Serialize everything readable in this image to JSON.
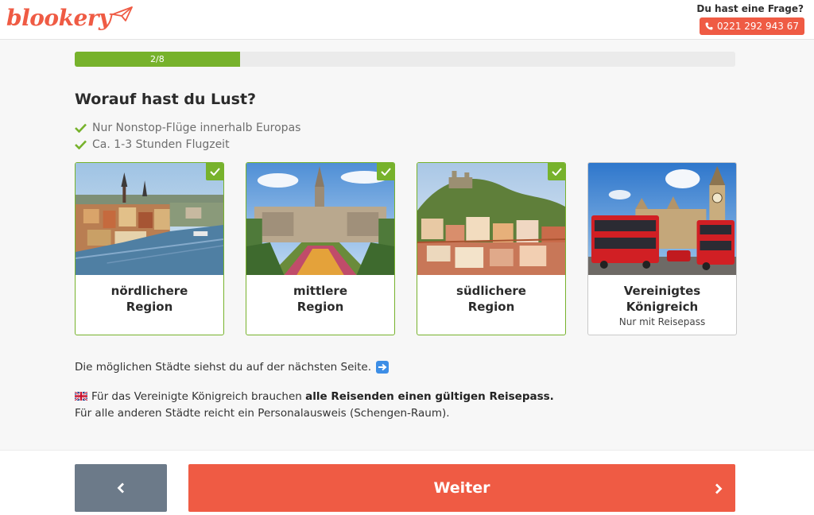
{
  "header": {
    "logo_text": "blookery",
    "help_question": "Du hast eine Frage?",
    "phone": "0221 292 943 67"
  },
  "progress": {
    "label": "2/8",
    "current_step": 2,
    "total_steps": 8
  },
  "question": "Worauf hast du Lust?",
  "features": [
    "Nur Nonstop-Flüge innerhalb Europas",
    "Ca. 1-3 Stunden Flugzeit"
  ],
  "regions": [
    {
      "title": "nördlichere\nRegion",
      "subtitle": "",
      "selected": true,
      "image": "stockholm-cityscape"
    },
    {
      "title": "mittlere\nRegion",
      "subtitle": "",
      "selected": true,
      "image": "brussels-mont-des-arts"
    },
    {
      "title": "südlichere\nRegion",
      "subtitle": "",
      "selected": true,
      "image": "lisbon-hillside"
    },
    {
      "title": "Vereinigtes\nKönigreich",
      "subtitle": "Nur mit Reisepass",
      "selected": false,
      "image": "london-big-ben-red-bus"
    }
  ],
  "info": {
    "next_page_note": "Die möglichen Städte siehst du auf der nächsten Seite.",
    "uk_prefix": "Für das Vereinigte Königreich brauchen ",
    "uk_bold": "alle Reisenden einen gültigen Reisepass.",
    "others": "Für alle anderen Städte reicht ein Personalausweis (Schengen-Raum)."
  },
  "footer": {
    "back_icon": "chevron-left-icon",
    "next_label": "Weiter",
    "next_icon": "chevron-right-icon"
  },
  "colors": {
    "brand": "#ef5b44",
    "accent_green": "#77b22c",
    "back_button": "#6c7a89"
  }
}
